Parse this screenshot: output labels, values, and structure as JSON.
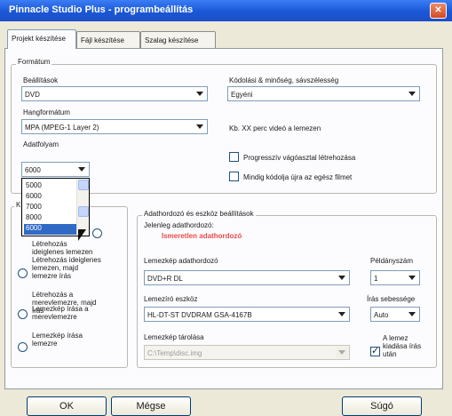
{
  "window": {
    "title": "Pinnacle Studio Plus - programbeállítás"
  },
  "tabs": [
    {
      "label": "Projekt készítése"
    },
    {
      "label": "Fájl készítése"
    },
    {
      "label": "Szalag készítése"
    }
  ],
  "format_group": {
    "legend": "Formátum",
    "preset_label": "Beállítások",
    "preset_value": "DVD",
    "audio_label": "Hangformátum",
    "audio_value": "MPA (MPEG-1 Layer 2)",
    "quality_label": "Kódolási & minőség, sávszélesség",
    "quality_value": "Egyéni",
    "video_note": "Kb. XX perc videó a lemezen",
    "progressive_label": "Progresszív vágóasztal létrehozása",
    "always_reencode_label": "Mindig kódolja újra az egész filmet",
    "bitrate_label": "Adatfolyam",
    "bitrate_value": "6000",
    "bitrate_options": [
      "5000",
      "6000",
      "7000",
      "8000",
      "6000"
    ]
  },
  "output_group": {
    "legend_char": "K",
    "options": [
      "Létrehozás ideiglenes lemezen",
      "Létrehozás ideiglenes lemezen, majd lemezre írás",
      "Létrehozás a merevlemezre, majd írás",
      "Lemezkép írása a merevlemezre",
      "Lemezkép írása lemezre"
    ]
  },
  "disc_group": {
    "legend": "Adathordozó és eszköz beállítások",
    "current_media_label": "Jelenleg adathordozó:",
    "current_media_value": "Ismeretlen adathordozó",
    "media_label": "Lemezkép adathordozó",
    "media_value": "DVD+R DL",
    "copies_label": "Példányszám",
    "copies_value": "1",
    "device_label": "Lemezíró eszköz",
    "device_value": "HL-DT-ST DVDRAM GSA-4167B",
    "speed_label": "Írás sebessége",
    "speed_value": "Auto",
    "image_label": "Lemezkép tárolása",
    "image_value": "C:\\Temp\\disc.img",
    "eject_label": "A lemez kiadása írás után",
    "eject_checked": true
  },
  "buttons": {
    "ok": "OK",
    "cancel": "Mégse",
    "help": "Súgó"
  }
}
